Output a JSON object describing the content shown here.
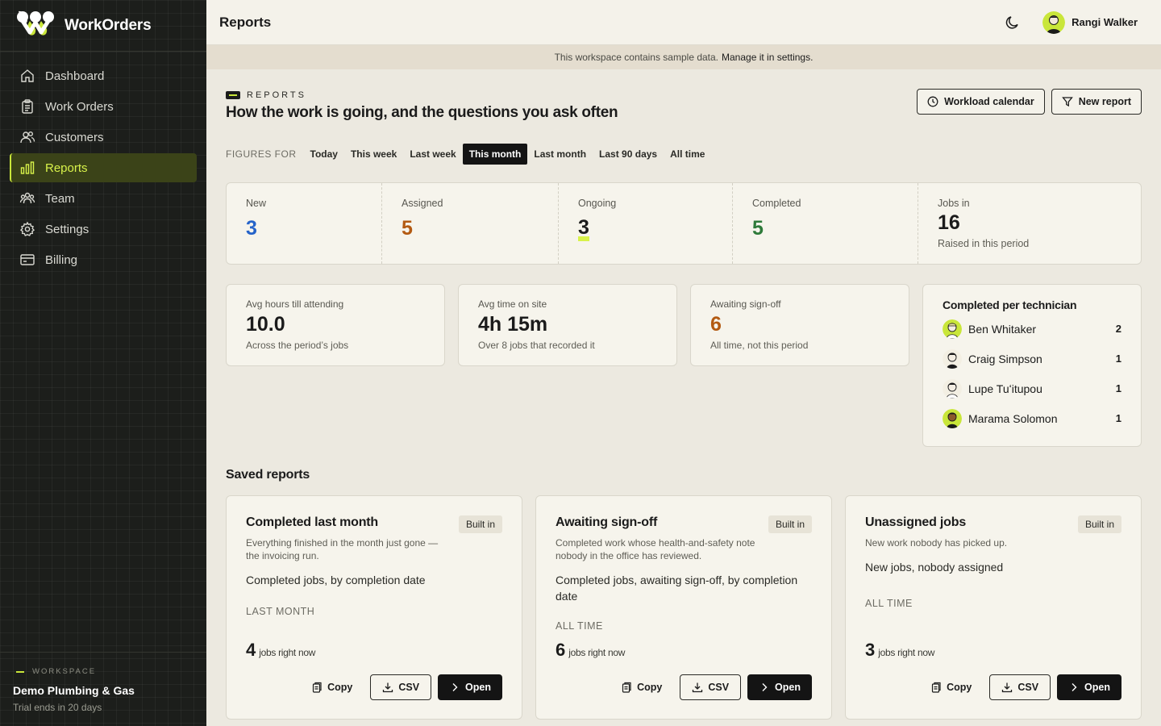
{
  "app": {
    "name": "WorkOrders"
  },
  "sidebar": {
    "items": [
      {
        "label": "Dashboard",
        "icon": "home-icon"
      },
      {
        "label": "Work Orders",
        "icon": "clipboard-icon"
      },
      {
        "label": "Customers",
        "icon": "users-icon"
      },
      {
        "label": "Reports",
        "icon": "bar-chart-icon",
        "active": true
      },
      {
        "label": "Team",
        "icon": "team-icon"
      },
      {
        "label": "Settings",
        "icon": "gear-icon"
      },
      {
        "label": "Billing",
        "icon": "card-icon"
      }
    ],
    "workspace": {
      "label": "WORKSPACE",
      "name": "Demo Plumbing & Gas",
      "trial": "Trial ends in 20 days"
    }
  },
  "topbar": {
    "title": "Reports",
    "user": "Rangi Walker"
  },
  "banner": {
    "text": "This workspace contains sample data.",
    "link": "Manage it in settings."
  },
  "page": {
    "eyebrow": "REPORTS",
    "headline": "How the work is going, and the questions you ask often",
    "buttons": {
      "calendar": "Workload calendar",
      "new_report": "New report"
    }
  },
  "periods": {
    "label": "FIGURES FOR",
    "options": [
      "Today",
      "This week",
      "Last week",
      "This month",
      "Last month",
      "Last 90 days",
      "All time"
    ],
    "selected": "This month"
  },
  "stats": [
    {
      "label": "New",
      "value": "3",
      "color": "#2563c9"
    },
    {
      "label": "Assigned",
      "value": "5",
      "color": "#b35a12"
    },
    {
      "label": "Ongoing",
      "value": "3",
      "color": "#1b1b1b"
    },
    {
      "label": "Completed",
      "value": "5",
      "color": "#2e7a3a"
    },
    {
      "label": "Jobs in",
      "value": "16",
      "sub": "Raised in this period",
      "color": "#1b1b1b"
    }
  ],
  "metrics": [
    {
      "label": "Avg hours till attending",
      "value": "10.0",
      "sub": "Across the period’s jobs",
      "color": "#1b1b1b"
    },
    {
      "label": "Avg time on site",
      "value": "4h 15m",
      "sub": "Over 8 jobs that recorded it",
      "color": "#1b1b1b"
    },
    {
      "label": "Awaiting sign-off",
      "value": "6",
      "sub": "All time, not this period",
      "color": "#b35a12"
    }
  ],
  "technicians": {
    "title": "Completed per technician",
    "list": [
      {
        "name": "Ben Whitaker",
        "count": "2"
      },
      {
        "name": "Craig Simpson",
        "count": "1"
      },
      {
        "name": "Lupe Tuʻitupou",
        "count": "1"
      },
      {
        "name": "Marama Solomon",
        "count": "1"
      }
    ]
  },
  "saved": {
    "title": "Saved reports",
    "badge": "Built in",
    "count_suffix": "jobs right now",
    "actions": {
      "copy": "Copy",
      "csv": "CSV",
      "open": "Open"
    },
    "reports": [
      {
        "title": "Completed last month",
        "desc": "Everything finished in the month just gone — the invoicing run.",
        "query": "Completed jobs, by completion date",
        "period": "LAST MONTH",
        "count": "4"
      },
      {
        "title": "Awaiting sign-off",
        "desc": "Completed work whose health-and-safety note nobody in the office has reviewed.",
        "query": "Completed jobs, awaiting sign-off, by completion date",
        "period": "ALL TIME",
        "count": "6"
      },
      {
        "title": "Unassigned jobs",
        "desc": "New work nobody has picked up.",
        "query": "New jobs, nobody assigned",
        "period": "ALL TIME",
        "count": "3"
      }
    ]
  }
}
